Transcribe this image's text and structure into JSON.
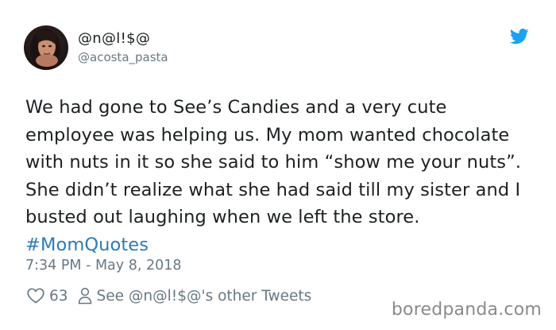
{
  "tweet": {
    "display_name": "@n@l!$@",
    "handle": "@acosta_pasta",
    "text": "We had gone to See’s Candies and a very cute employee was helping us. My mom wanted chocolate with nuts in it so she said to him “show me your nuts”. She didn’t realize what she had said till my sister and I busted out laughing when we left the store. ",
    "hashtag": "#MomQuotes",
    "timestamp": "7:34 PM - May 8, 2018",
    "like_count": "63",
    "other_tweets_link": "See @n@l!$@'s other Tweets"
  },
  "icons": {
    "logo": "twitter-bird-icon",
    "like": "heart-icon",
    "profile": "user-icon"
  },
  "watermark": "boredpanda.com",
  "colors": {
    "twitter_blue": "#1da1f2",
    "hashtag": "#2b7bb9",
    "secondary_text": "#697882",
    "primary_text": "#1c2022"
  }
}
